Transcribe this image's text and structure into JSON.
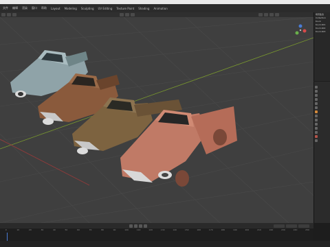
{
  "app": {
    "name": "Blender"
  },
  "menu": {
    "items": [
      "文件",
      "编辑",
      "渲染",
      "窗口",
      "帮助",
      "Layout",
      "Modeling",
      "Sculpting",
      "UV Editing",
      "Texture Paint",
      "Shading",
      "Animation"
    ]
  },
  "outliner": {
    "items": [
      "场景集合",
      "Collection",
      "truck",
      "truck.001",
      "truck.002",
      "truck.003"
    ]
  },
  "properties": {
    "tabs": [
      "tool-icon",
      "render-icon",
      "output-icon",
      "view-layer-icon",
      "scene-icon",
      "world-icon",
      "object-icon",
      "modifier-icon",
      "particles-icon",
      "physics-icon",
      "constraints-icon",
      "data-icon",
      "material-icon",
      "texture-icon"
    ]
  },
  "timeline": {
    "ticks": [
      "0",
      "10",
      "20",
      "30",
      "40",
      "50",
      "60",
      "70",
      "80",
      "90",
      "100",
      "110",
      "120",
      "130",
      "140",
      "150",
      "160",
      "170",
      "180",
      "190",
      "200",
      "210",
      "220",
      "230",
      "240",
      "250"
    ],
    "frame_current": "1",
    "frame_start": "1",
    "frame_end": "250"
  },
  "status": {
    "left": "",
    "right": ""
  },
  "colors": {
    "viewport": "#3f3f3f",
    "truck_blue": "#8fa3a8",
    "truck_rust": "#8a5a3c",
    "truck_red": "#c07a66"
  }
}
